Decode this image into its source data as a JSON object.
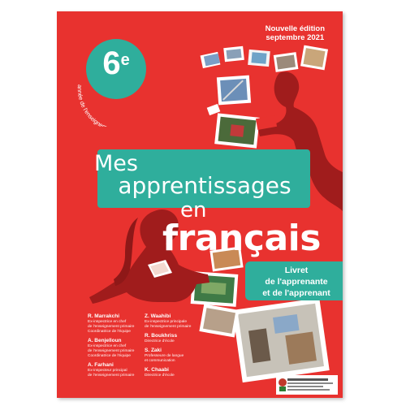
{
  "cover": {
    "edition_line1": "Nouvelle édition",
    "edition_line2": "septembre 2021",
    "grade_number": "6",
    "grade_sup": "e",
    "grade_subtitle": "année de l'enseignement primaire",
    "title_mes": "Mes",
    "title_apprentissages": "apprentissages",
    "title_en": "en",
    "title_francais": "français",
    "livret_line1": "Livret",
    "livret_line2": "de l'apprenante",
    "livret_line3": "et de l'apprenant"
  },
  "authors_left": [
    {
      "name": "R. Marrakchi",
      "role1": "Ex-inspectrice en chef",
      "role2": "de l'enseignement primaire",
      "role3": "Coordinatrice de l'équipe"
    },
    {
      "name": "A. Benjelloun",
      "role1": "Ex-inspectrice en chef",
      "role2": "de l'enseignement primaire",
      "role3": "Coordinatrice de l'équipe"
    },
    {
      "name": "A. Farhani",
      "role1": "Ex-inspecteur principal",
      "role2": "de l'enseignement primaire",
      "role3": ""
    }
  ],
  "authors_right": [
    {
      "name": "Z. Waahibi",
      "role1": "Ex-inspectrice principale",
      "role2": "de l'enseignement primaire"
    },
    {
      "name": "R. Boukhriss",
      "role1": "Directrice d'école",
      "role2": ""
    },
    {
      "name": "S. Zaki",
      "role1": "Professeure de langue",
      "role2": "et communication"
    },
    {
      "name": "K. Chaabi",
      "role1": "Directrice d'école",
      "role2": ""
    }
  ],
  "colors": {
    "cover_red": "#e8322f",
    "teal": "#2fae9c",
    "silhouette": "#a01c1c"
  }
}
